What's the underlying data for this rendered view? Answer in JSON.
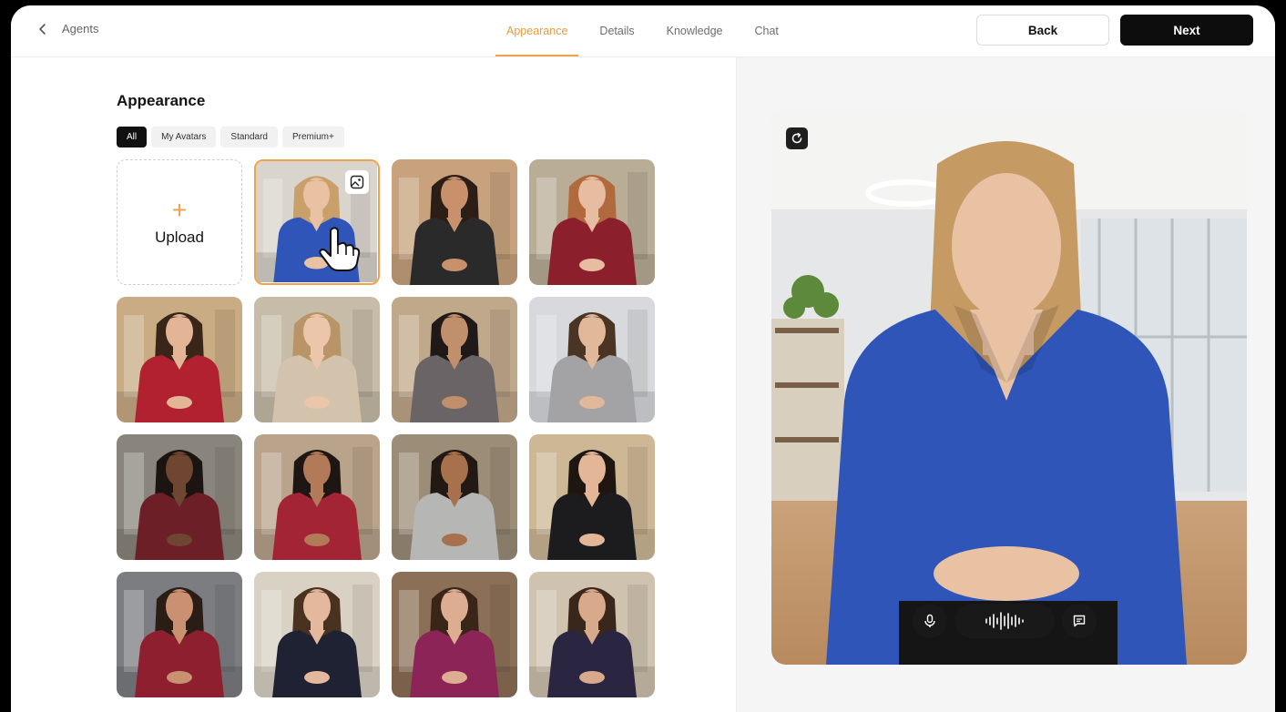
{
  "header": {
    "back_link_label": "Agents",
    "tabs": [
      {
        "label": "Appearance",
        "active": true
      },
      {
        "label": "Details",
        "active": false
      },
      {
        "label": "Knowledge",
        "active": false
      },
      {
        "label": "Chat",
        "active": false
      }
    ],
    "back_button": "Back",
    "next_button": "Next"
  },
  "appearance": {
    "title": "Appearance",
    "filters": [
      {
        "label": "All",
        "active": true
      },
      {
        "label": "My Avatars",
        "active": false
      },
      {
        "label": "Standard",
        "active": false
      },
      {
        "label": "Premium+",
        "active": false
      }
    ],
    "upload_label": "Upload",
    "avatars": [
      {
        "shirt": "#2f55b8",
        "skin": "#e9c2a4",
        "hair": "#c9a06a",
        "bg": "#d9d4cc",
        "selected": true
      },
      {
        "shirt": "#2a2a2a",
        "skin": "#c8916c",
        "hair": "#2c1e16",
        "bg": "#c7a27c"
      },
      {
        "shirt": "#8b1f2b",
        "skin": "#e8bca0",
        "hair": "#b06a3e",
        "bg": "#b9ad96"
      },
      {
        "shirt": "#b1212f",
        "skin": "#e3b596",
        "hair": "#3a2618",
        "bg": "#c9ab84"
      },
      {
        "shirt": "#d3c3ad",
        "skin": "#ebc6ab",
        "hair": "#b89466",
        "bg": "#c7bca8"
      },
      {
        "shirt": "#6a6466",
        "skin": "#c08f6b",
        "hair": "#1f1a17",
        "bg": "#c0a88a"
      },
      {
        "shirt": "#a3a3a5",
        "skin": "#e2b89a",
        "hair": "#4a3524",
        "bg": "#d7d9dc"
      },
      {
        "shirt": "#6d1f28",
        "skin": "#6e4631",
        "hair": "#1b1410",
        "bg": "#8a857c"
      },
      {
        "shirt": "#a32434",
        "skin": "#b27a58",
        "hair": "#1e1612",
        "bg": "#b9a38a"
      },
      {
        "shirt": "#b6b6b4",
        "skin": "#a8714e",
        "hair": "#221914",
        "bg": "#9c8d78"
      },
      {
        "shirt": "#1c1c1f",
        "skin": "#e3b698",
        "hair": "#1f1612",
        "bg": "#cdb795"
      },
      {
        "shirt": "#8d1f2e",
        "skin": "#c99072",
        "hair": "#2a1d16",
        "bg": "#7b7d80"
      },
      {
        "shirt": "#1f2232",
        "skin": "#e3b89c",
        "hair": "#4a3220",
        "bg": "#d9d2c4"
      },
      {
        "shirt": "#8d2457",
        "skin": "#dcad90",
        "hair": "#3a2618",
        "bg": "#8c6f57"
      },
      {
        "shirt": "#2a2540",
        "skin": "#d8a98b",
        "hair": "#3a271b",
        "bg": "#cfc2ae"
      }
    ]
  },
  "preview": {
    "avatar": {
      "shirt": "#2f55b8",
      "skin": "#e9c2a4",
      "hair": "#c59a63",
      "bg": "#e6e7e8"
    },
    "refresh_icon": "refresh-icon",
    "mic_icon": "microphone-icon",
    "wave_icon": "sound-wave-icon",
    "chat_icon": "chat-bubble-icon"
  }
}
